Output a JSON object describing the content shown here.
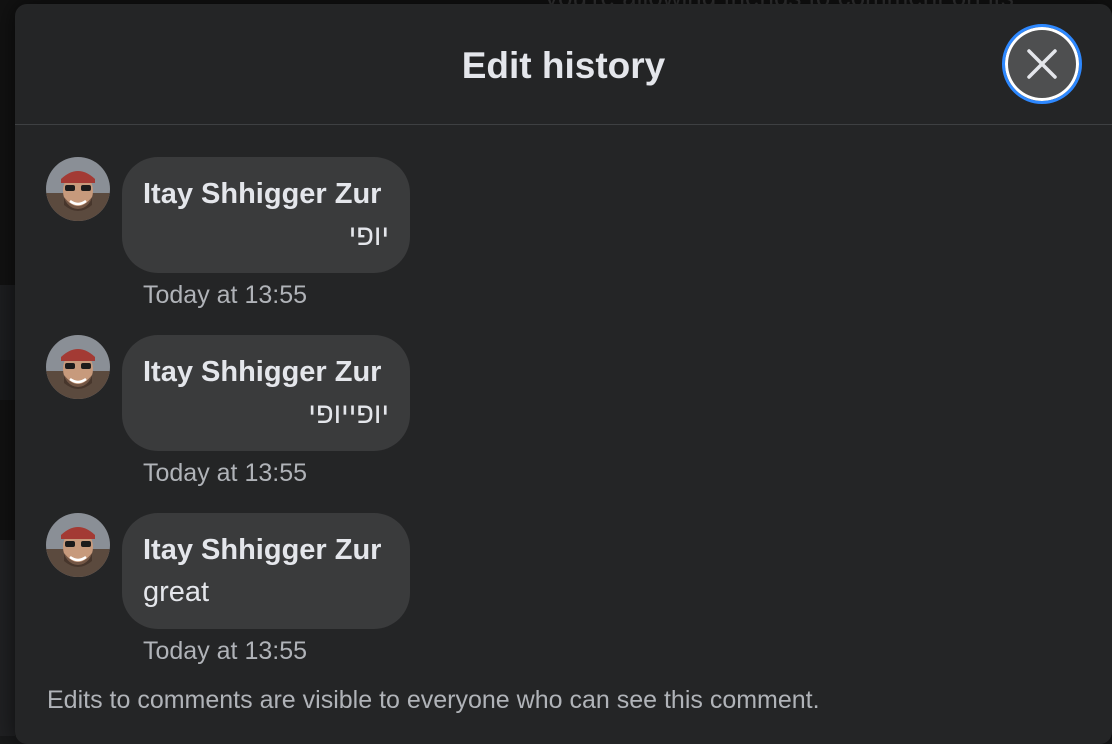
{
  "background": {
    "ghost_text": "you're allowing friends to comment on its"
  },
  "modal": {
    "title": "Edit history",
    "close_icon": "close-icon",
    "footer_note": "Edits to comments are visible to everyone who can see this comment."
  },
  "entries": [
    {
      "author": "Itay Shhigger Zur",
      "text": "יופי",
      "text_direction": "rtl",
      "timestamp": "Today at 13:55"
    },
    {
      "author": "Itay Shhigger Zur",
      "text": "יופייופי",
      "text_direction": "rtl",
      "timestamp": "Today at 13:55"
    },
    {
      "author": "Itay Shhigger Zur",
      "text": "great",
      "text_direction": "ltr",
      "timestamp": "Today at 13:55"
    }
  ],
  "colors": {
    "modal_bg": "#242526",
    "bubble_bg": "#3a3b3c",
    "primary_text": "#e4e6eb",
    "secondary_text": "#b0b3b8",
    "focus_ring": "#2d88ff"
  }
}
